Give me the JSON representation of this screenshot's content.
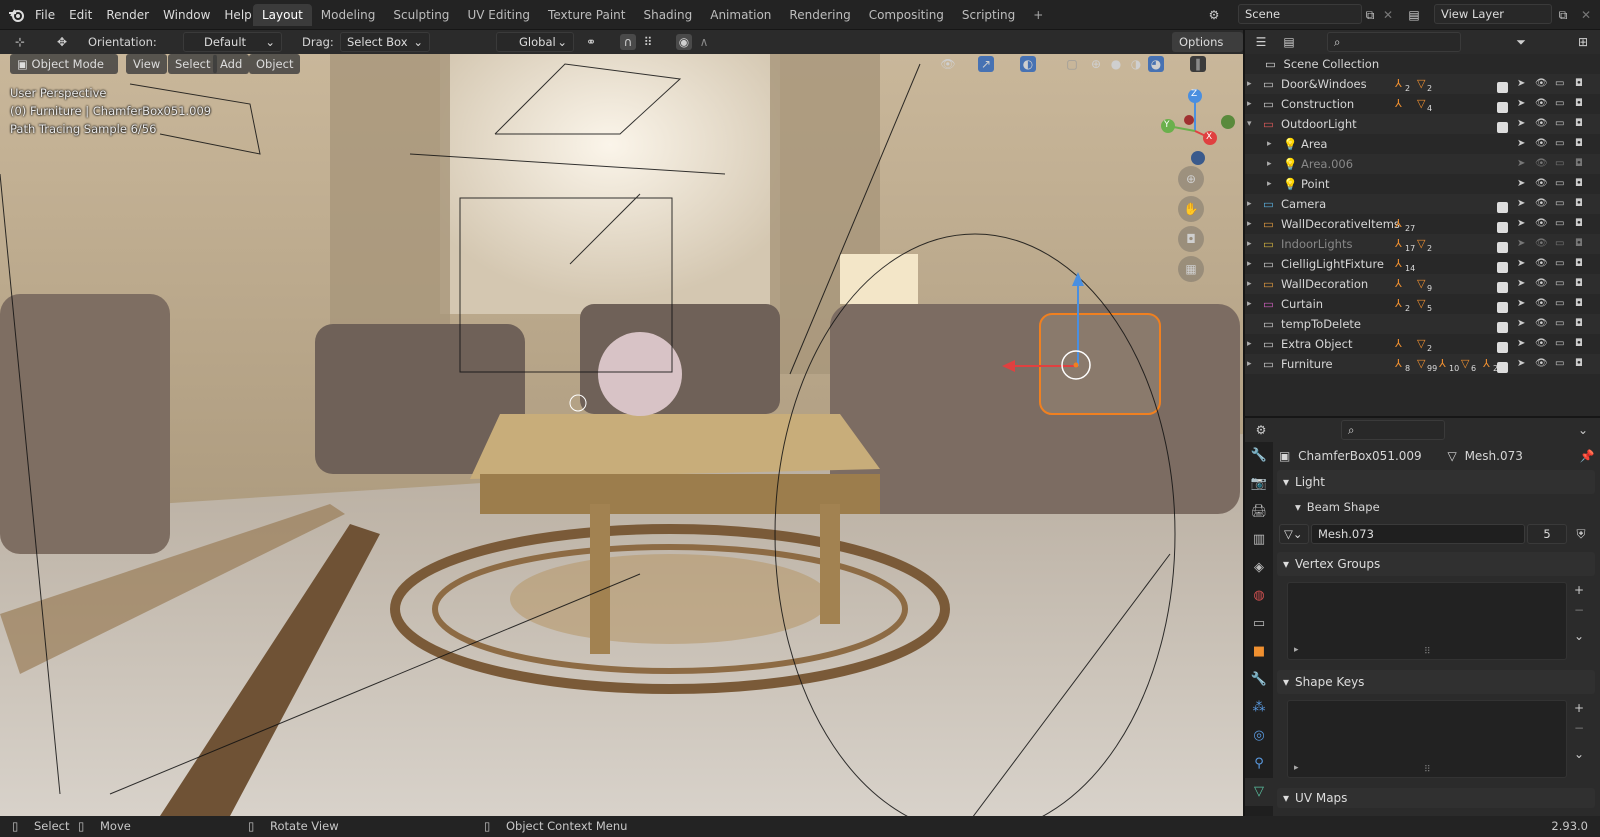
{
  "app": {
    "version": "2.93.0"
  },
  "menus": [
    "File",
    "Edit",
    "Render",
    "Window",
    "Help"
  ],
  "workspaces": [
    {
      "label": "Layout",
      "active": true
    },
    {
      "label": "Modeling"
    },
    {
      "label": "Sculpting"
    },
    {
      "label": "UV Editing"
    },
    {
      "label": "Texture Paint"
    },
    {
      "label": "Shading"
    },
    {
      "label": "Animation"
    },
    {
      "label": "Rendering"
    },
    {
      "label": "Compositing"
    },
    {
      "label": "Scripting"
    }
  ],
  "scene": {
    "name": "Scene"
  },
  "view_layer": {
    "name": "View Layer"
  },
  "tool_header": {
    "orientation_label": "Orientation:",
    "orientation_value": "Default",
    "drag_label": "Drag:",
    "drag_value": "Select Box",
    "transform_orientation": "Global",
    "options_label": "Options"
  },
  "viewport_header": {
    "mode": "Object Mode",
    "menus": [
      "View",
      "Select",
      "Add",
      "Object"
    ]
  },
  "viewport_overlay": {
    "perspective": "User Perspective",
    "object_info": "(0) Furniture | ChamferBox051.009",
    "sample_info": "Path Tracing Sample 6/56"
  },
  "gizmo": {
    "z": "Z",
    "y": "Y",
    "x": "X"
  },
  "outliner": {
    "root": "Scene Collection",
    "items": [
      {
        "name": "Door&Windoes",
        "indent": 0,
        "badges": [
          "2",
          "2"
        ],
        "color": "#cfcfcf",
        "dim": false
      },
      {
        "name": "Construction",
        "indent": 0,
        "badges": [
          "",
          "4"
        ],
        "color": "#cfcfcf",
        "dim": false
      },
      {
        "name": "OutdoorLight",
        "indent": 0,
        "badges": [],
        "color": "#e05a5a",
        "dim": false,
        "expanded": true
      },
      {
        "name": "Area",
        "indent": 1,
        "badges": [],
        "color": "#e0a050",
        "dim": false,
        "light": true
      },
      {
        "name": "Area.006",
        "indent": 1,
        "badges": [],
        "color": "#e0a050",
        "dim": true,
        "light": true
      },
      {
        "name": "Point",
        "indent": 1,
        "badges": [],
        "color": "#e0a050",
        "dim": false,
        "light": true
      },
      {
        "name": "Camera",
        "indent": 0,
        "badges": [],
        "color": "#5ab0e0",
        "dim": false
      },
      {
        "name": "WallDecorativeItems",
        "indent": 0,
        "badges": [
          "27"
        ],
        "color": "#e09a40",
        "dim": false
      },
      {
        "name": "IndoorLights",
        "indent": 0,
        "badges": [
          "17",
          "2"
        ],
        "color": "#d0b040",
        "dim": true
      },
      {
        "name": "CielligLightFixture",
        "indent": 0,
        "badges": [
          "14"
        ],
        "color": "#cfcfcf",
        "dim": false
      },
      {
        "name": "WallDecoration",
        "indent": 0,
        "badges": [
          "",
          "9"
        ],
        "color": "#e09a40",
        "dim": false
      },
      {
        "name": "Curtain",
        "indent": 0,
        "badges": [
          "2",
          "5"
        ],
        "color": "#d060c0",
        "dim": false
      },
      {
        "name": "tempToDelete",
        "indent": 0,
        "badges": [],
        "color": "#cfcfcf",
        "dim": false,
        "noarrow": true
      },
      {
        "name": "Extra Object",
        "indent": 0,
        "badges": [
          "",
          "2"
        ],
        "color": "#cfcfcf",
        "dim": false
      },
      {
        "name": "Furniture",
        "indent": 0,
        "badges": [
          "8",
          "99",
          "10",
          "6",
          "2"
        ],
        "color": "#cfcfcf",
        "dim": false
      }
    ]
  },
  "properties": {
    "object_name": "ChamferBox051.009",
    "mesh_name": "Mesh.073",
    "panels": [
      "Light",
      "Beam Shape",
      "Vertex Groups",
      "Shape Keys",
      "UV Maps"
    ],
    "mesh_datablock": "Mesh.073",
    "mesh_users": "5"
  },
  "statusbar": {
    "select": "Select",
    "move": "Move",
    "rotate": "Rotate View",
    "context": "Object Context Menu"
  }
}
